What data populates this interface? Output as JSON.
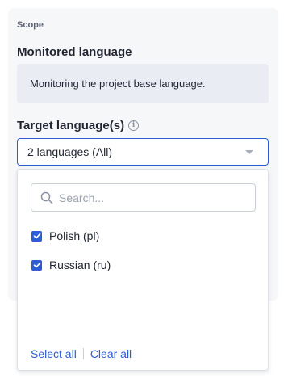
{
  "scope": {
    "label": "Scope"
  },
  "monitored": {
    "title": "Monitored language",
    "info": "Monitoring the project base language."
  },
  "target": {
    "title": "Target language(s)",
    "info_icon": "info-circle-icon",
    "selected_value": "2 languages (All)"
  },
  "dropdown": {
    "search_placeholder": "Search...",
    "search_value": "",
    "options": [
      {
        "label": "Polish (pl)",
        "checked": true
      },
      {
        "label": "Russian (ru)",
        "checked": true
      }
    ],
    "select_all_label": "Select all",
    "clear_all_label": "Clear all"
  },
  "colors": {
    "accent": "#2d5bd3",
    "panel_bg": "#f6f7f9",
    "info_bg": "#e9edf3"
  }
}
